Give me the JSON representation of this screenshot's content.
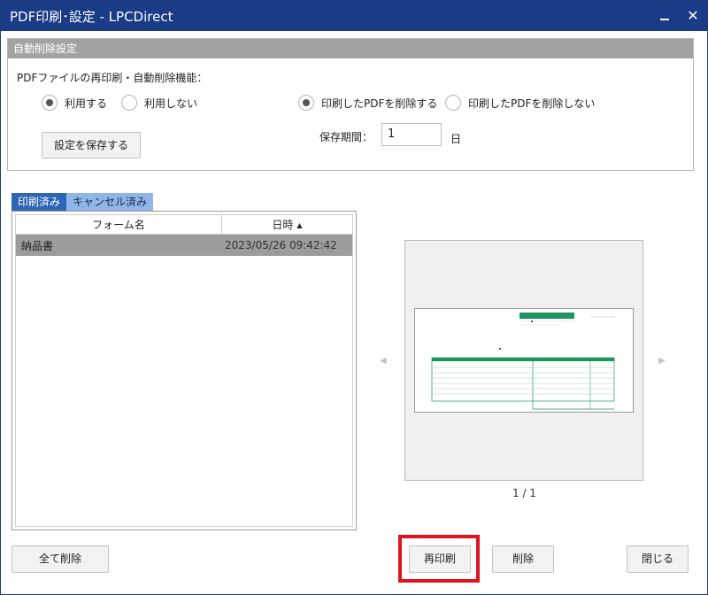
{
  "window": {
    "title": "PDF印刷･設定 - LPCDirect",
    "minimize_icon": "minimize-icon",
    "close_glyph": "✕"
  },
  "settings": {
    "header": "自動削除設定",
    "function_label": "PDFファイルの再印刷・自動削除機能：",
    "use_options": [
      {
        "label": "利用する",
        "checked": true
      },
      {
        "label": "利用しない",
        "checked": false
      }
    ],
    "delete_options": [
      {
        "label": "印刷したPDFを削除する",
        "checked": true
      },
      {
        "label": "印刷したPDFを削除しない",
        "checked": false
      }
    ],
    "save_button": "設定を保存する",
    "period_label": "保存期間：",
    "period_value": "1",
    "period_unit": "日"
  },
  "tabs": [
    {
      "label": "印刷済み",
      "active": true
    },
    {
      "label": "キャンセル済み",
      "active": false
    }
  ],
  "table": {
    "columns": [
      "フォーム名",
      "日時"
    ],
    "sort_glyph": "▲",
    "rows": [
      {
        "form_name": "納品書",
        "datetime": "2023/05/26 09:42:42",
        "selected": true
      }
    ]
  },
  "preview": {
    "prev_glyph": "◀",
    "next_glyph": "▶",
    "page_indicator": "1 / 1",
    "accent_color": "#1e9460"
  },
  "buttons": {
    "delete_all": "全て削除",
    "reprint": "再印刷",
    "delete": "削除",
    "close": "閉じる"
  },
  "colors": {
    "titlebar": "#1a3b86",
    "highlight": "#e0141e",
    "tab_active": "#2e66b6",
    "tab_inactive": "#8fb6e8"
  }
}
